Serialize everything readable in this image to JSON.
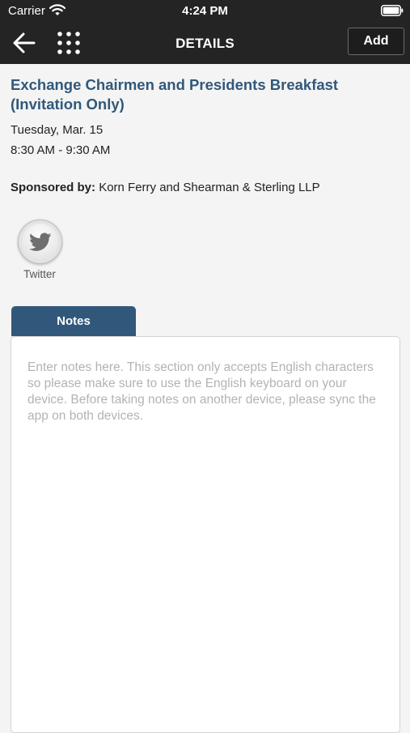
{
  "status_bar": {
    "carrier": "Carrier",
    "time": "4:24 PM"
  },
  "nav": {
    "title": "DETAILS",
    "add_label": "Add",
    "back_icon": "arrow-left-icon",
    "menu_icon": "grid-dots-icon"
  },
  "event": {
    "title": "Exchange Chairmen and Presidents Breakfast (Invitation Only)",
    "date": "Tuesday, Mar. 15",
    "time": "8:30 AM - 9:30 AM",
    "sponsor_label": "Sponsored by:",
    "sponsor_value": "Korn Ferry and Shearman & Sterling LLP"
  },
  "social": {
    "twitter_label": "Twitter",
    "twitter_icon": "twitter-bird-icon"
  },
  "notes": {
    "tab_label": "Notes",
    "placeholder": "Enter notes here. This section only accepts English characters so please make sure to use the English keyboard on your device. Before taking notes on another device, please sync the app on both devices."
  },
  "colors": {
    "header_bg": "#242424",
    "accent": "#31587b",
    "page_bg": "#f4f4f4"
  }
}
